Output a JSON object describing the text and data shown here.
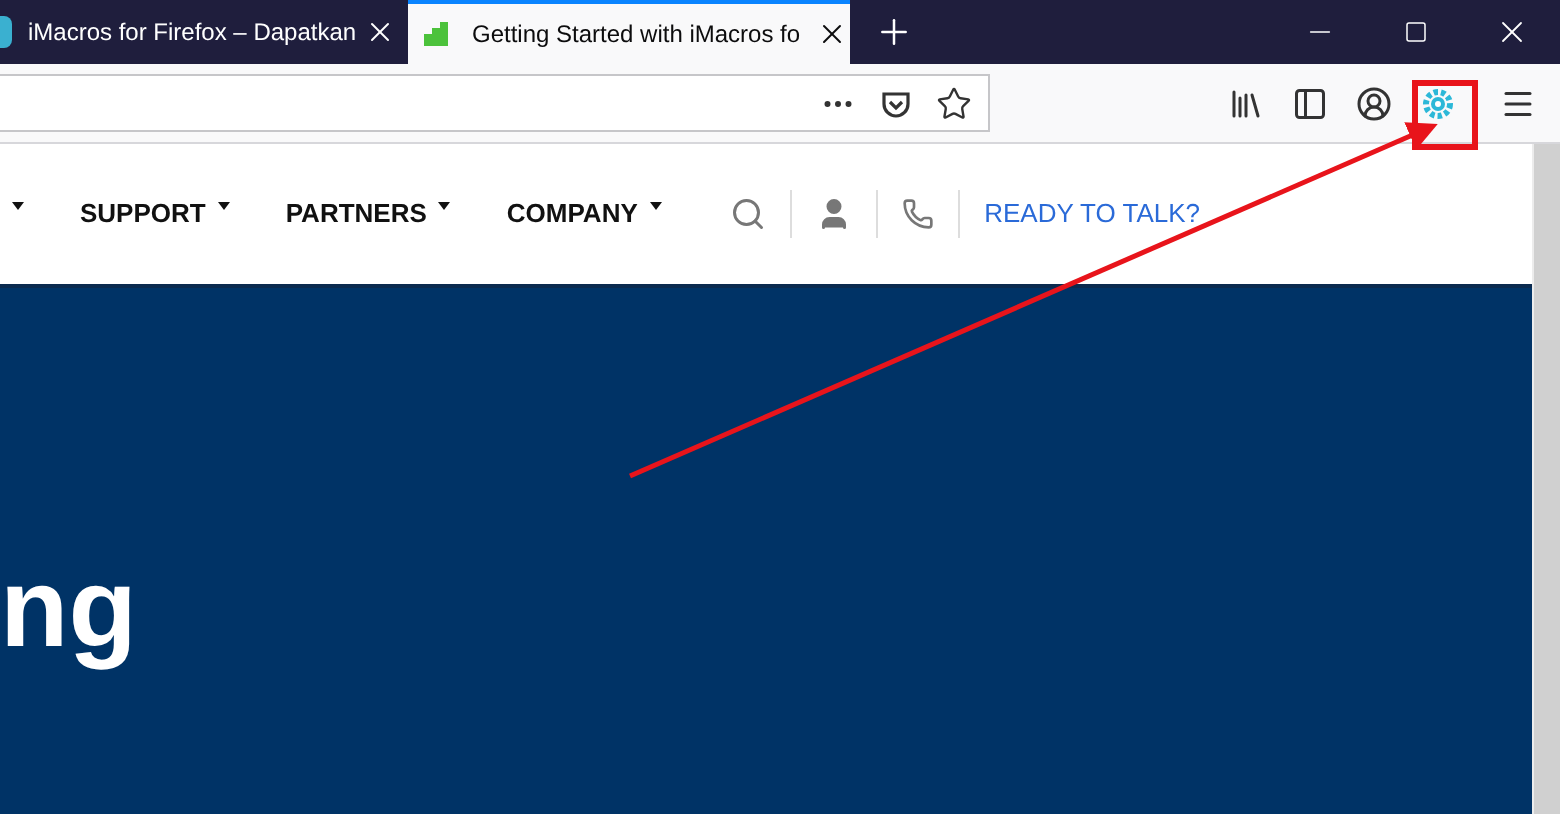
{
  "tabs": [
    {
      "title": "iMacros for Firefox – Dapatkan",
      "selected": false
    },
    {
      "title": "Getting Started with iMacros fo",
      "selected": true
    }
  ],
  "nav": {
    "items": [
      "SUPPORT",
      "PARTNERS",
      "COMPANY"
    ],
    "cta": "READY TO TALK?"
  },
  "hero": {
    "heading": "ng"
  }
}
